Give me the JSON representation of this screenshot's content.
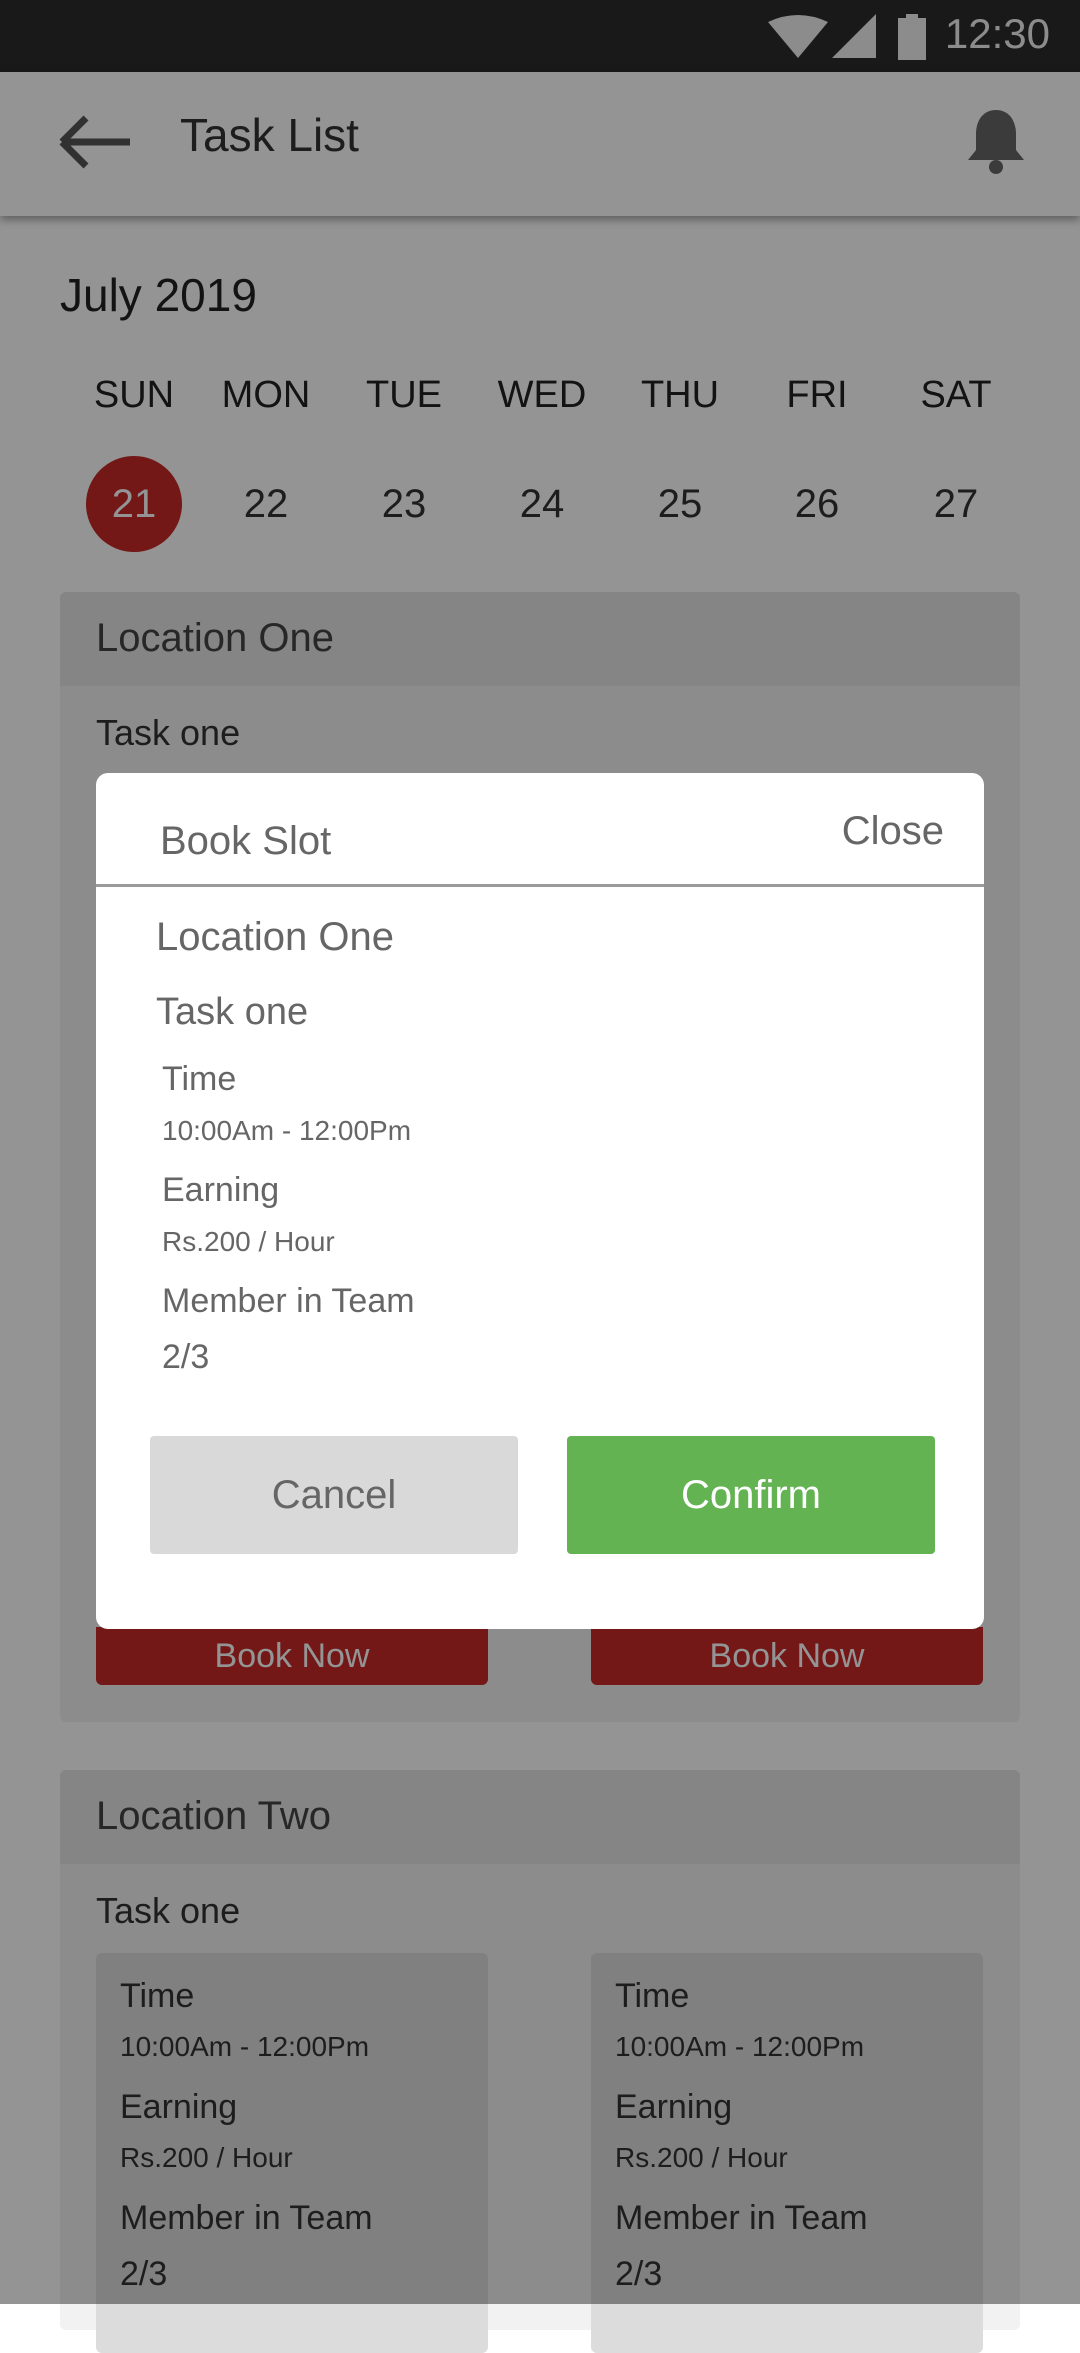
{
  "status_bar": {
    "time": "12:30",
    "icons": [
      "wifi-icon",
      "signal-icon",
      "battery-icon"
    ]
  },
  "app_bar": {
    "title": "Task List",
    "icons": [
      "back-arrow-icon",
      "bell-icon"
    ]
  },
  "calendar": {
    "month": "July 2019",
    "days": [
      {
        "label": "SUN",
        "num": "21",
        "selected": true
      },
      {
        "label": "MON",
        "num": "22",
        "selected": false
      },
      {
        "label": "TUE",
        "num": "23",
        "selected": false
      },
      {
        "label": "WED",
        "num": "24",
        "selected": false
      },
      {
        "label": "THU",
        "num": "25",
        "selected": false
      },
      {
        "label": "FRI",
        "num": "26",
        "selected": false
      },
      {
        "label": "SAT",
        "num": "27",
        "selected": false
      }
    ]
  },
  "locations": [
    {
      "title": "Location One",
      "task": "Task one",
      "book_now": "Book Now"
    },
    {
      "title": "Location Two",
      "task": "Task one",
      "slots": [
        {
          "time_label": "Time",
          "time": "10:00Am - 12:00Pm",
          "earning_label": "Earning",
          "earning": "Rs.200 / Hour",
          "team_label": "Member in Team",
          "team": "2/3"
        },
        {
          "time_label": "Time",
          "time": "10:00Am - 12:00Pm",
          "earning_label": "Earning",
          "earning": "Rs.200 / Hour",
          "team_label": "Member in Team",
          "team": "2/3"
        }
      ]
    }
  ],
  "dialog": {
    "title": "Book Slot",
    "close": "Close",
    "location": "Location One",
    "task": "Task one",
    "time_label": "Time",
    "time": "10:00Am - 12:00Pm",
    "earning_label": "Earning",
    "earning": "Rs.200 / Hour",
    "team_label": "Member in Team",
    "team": "2/3",
    "cancel": "Cancel",
    "confirm": "Confirm"
  },
  "colors": {
    "accent_red": "#c62828",
    "confirm_green": "#63b352",
    "cancel_gray": "#d9d9d9",
    "status_bar": "#2b2b2b"
  }
}
